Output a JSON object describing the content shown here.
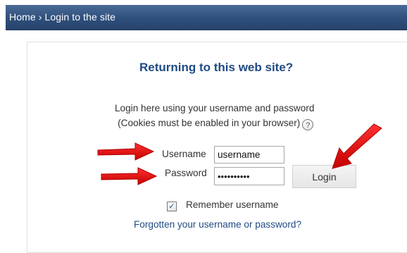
{
  "breadcrumb": {
    "home": "Home",
    "separator": "›",
    "current": "Login to the site"
  },
  "login": {
    "heading": "Returning to this web site?",
    "instruction_line1": "Login here using your username and password",
    "instruction_line2": "(Cookies must be enabled in your browser)",
    "help_icon": "?",
    "username_label": "Username",
    "username_value": "username",
    "password_label": "Password",
    "password_value": "••••••••••",
    "login_button": "Login",
    "remember_checked": true,
    "remember_check_mark": "✓",
    "remember_label": "Remember username",
    "forgot_link": "Forgotten your username or password?"
  },
  "colors": {
    "navbar": "#2f4f7b",
    "heading": "#1f4a84",
    "annotation_arrow": "#e00000"
  },
  "icons": {
    "help": "question-circle-icon",
    "checkbox": "checkmark-icon",
    "annotation": "red-arrow-icon"
  }
}
